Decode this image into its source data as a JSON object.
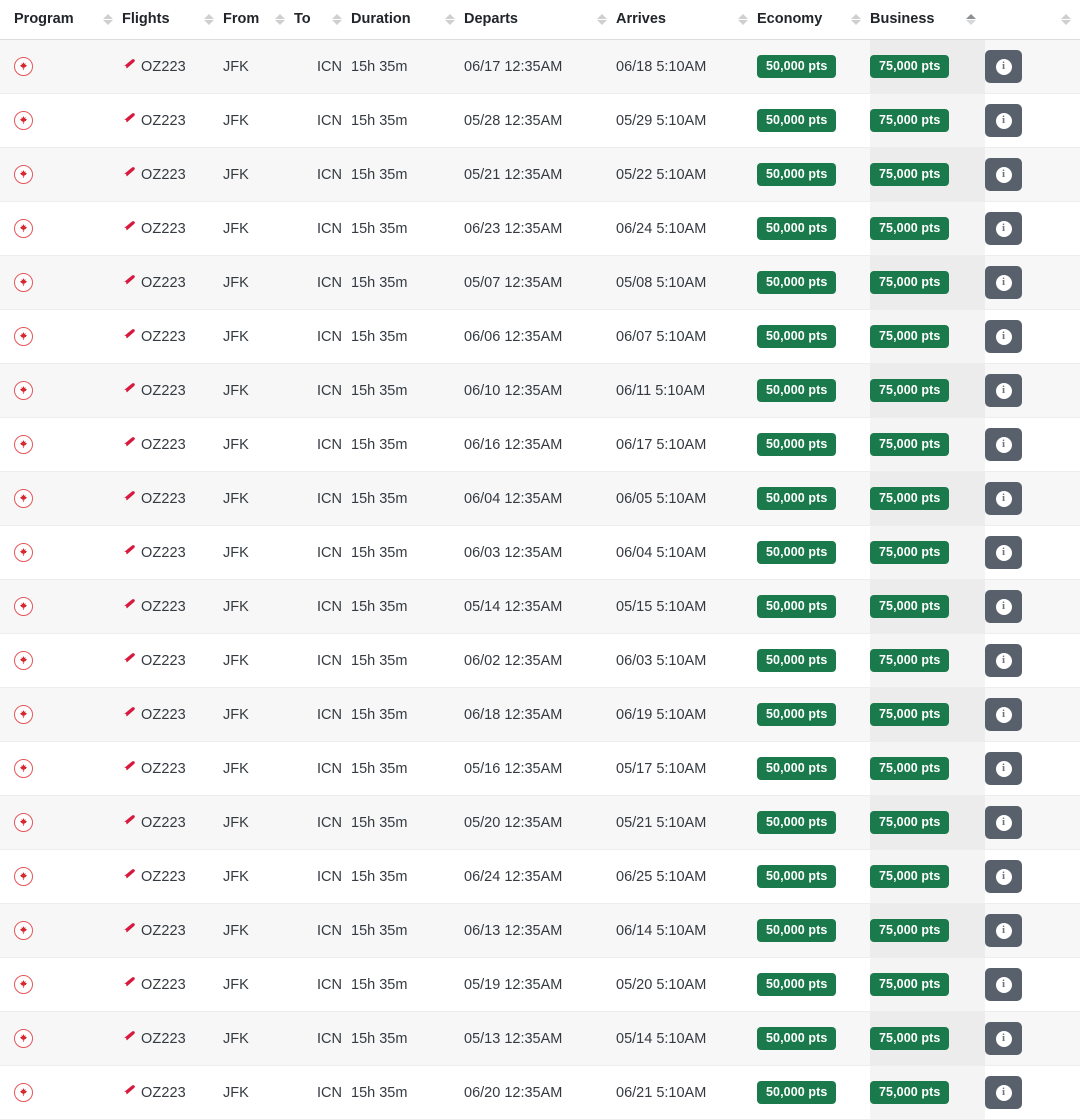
{
  "table": {
    "columns": [
      {
        "key": "program",
        "label": "Program",
        "sortable": true,
        "sort_state": "none"
      },
      {
        "key": "flights",
        "label": "Flights",
        "sortable": true,
        "sort_state": "none"
      },
      {
        "key": "from",
        "label": "From",
        "sortable": true,
        "sort_state": "none"
      },
      {
        "key": "to",
        "label": "To",
        "sortable": true,
        "sort_state": "none"
      },
      {
        "key": "duration",
        "label": "Duration",
        "sortable": true,
        "sort_state": "none"
      },
      {
        "key": "departs",
        "label": "Departs",
        "sortable": true,
        "sort_state": "none"
      },
      {
        "key": "arrives",
        "label": "Arrives",
        "sortable": true,
        "sort_state": "none"
      },
      {
        "key": "economy",
        "label": "Economy",
        "sortable": true,
        "sort_state": "none"
      },
      {
        "key": "business",
        "label": "Business",
        "sortable": true,
        "sort_state": "asc"
      },
      {
        "key": "info",
        "label": "",
        "sortable": true,
        "sort_state": "none"
      }
    ],
    "icons": {
      "program_logo": "aeroplan-maple-leaf-icon",
      "flight": "airplane-takeoff-icon",
      "info": "info-circle-icon",
      "sort": "sort-diamond-icon"
    },
    "colors": {
      "badge_green": "#1b7a4b",
      "info_button": "#58616b",
      "program_logo_red": "#e4565c",
      "plane_icon_red": "#d6193c",
      "row_stripe": "#f7f7f7",
      "sorted_column": "#ececec"
    },
    "rows": [
      {
        "program": "Aeroplan",
        "flight": "OZ223",
        "from": "JFK",
        "to": "ICN",
        "duration": "15h 35m",
        "departs": "06/17 12:35AM",
        "arrives": "06/18 5:10AM",
        "economy": "50,000 pts",
        "business": "75,000 pts",
        "info_label": "i"
      },
      {
        "program": "Aeroplan",
        "flight": "OZ223",
        "from": "JFK",
        "to": "ICN",
        "duration": "15h 35m",
        "departs": "05/28 12:35AM",
        "arrives": "05/29 5:10AM",
        "economy": "50,000 pts",
        "business": "75,000 pts",
        "info_label": "i"
      },
      {
        "program": "Aeroplan",
        "flight": "OZ223",
        "from": "JFK",
        "to": "ICN",
        "duration": "15h 35m",
        "departs": "05/21 12:35AM",
        "arrives": "05/22 5:10AM",
        "economy": "50,000 pts",
        "business": "75,000 pts",
        "info_label": "i"
      },
      {
        "program": "Aeroplan",
        "flight": "OZ223",
        "from": "JFK",
        "to": "ICN",
        "duration": "15h 35m",
        "departs": "06/23 12:35AM",
        "arrives": "06/24 5:10AM",
        "economy": "50,000 pts",
        "business": "75,000 pts",
        "info_label": "i"
      },
      {
        "program": "Aeroplan",
        "flight": "OZ223",
        "from": "JFK",
        "to": "ICN",
        "duration": "15h 35m",
        "departs": "05/07 12:35AM",
        "arrives": "05/08 5:10AM",
        "economy": "50,000 pts",
        "business": "75,000 pts",
        "info_label": "i"
      },
      {
        "program": "Aeroplan",
        "flight": "OZ223",
        "from": "JFK",
        "to": "ICN",
        "duration": "15h 35m",
        "departs": "06/06 12:35AM",
        "arrives": "06/07 5:10AM",
        "economy": "50,000 pts",
        "business": "75,000 pts",
        "info_label": "i"
      },
      {
        "program": "Aeroplan",
        "flight": "OZ223",
        "from": "JFK",
        "to": "ICN",
        "duration": "15h 35m",
        "departs": "06/10 12:35AM",
        "arrives": "06/11 5:10AM",
        "economy": "50,000 pts",
        "business": "75,000 pts",
        "info_label": "i"
      },
      {
        "program": "Aeroplan",
        "flight": "OZ223",
        "from": "JFK",
        "to": "ICN",
        "duration": "15h 35m",
        "departs": "06/16 12:35AM",
        "arrives": "06/17 5:10AM",
        "economy": "50,000 pts",
        "business": "75,000 pts",
        "info_label": "i"
      },
      {
        "program": "Aeroplan",
        "flight": "OZ223",
        "from": "JFK",
        "to": "ICN",
        "duration": "15h 35m",
        "departs": "06/04 12:35AM",
        "arrives": "06/05 5:10AM",
        "economy": "50,000 pts",
        "business": "75,000 pts",
        "info_label": "i"
      },
      {
        "program": "Aeroplan",
        "flight": "OZ223",
        "from": "JFK",
        "to": "ICN",
        "duration": "15h 35m",
        "departs": "06/03 12:35AM",
        "arrives": "06/04 5:10AM",
        "economy": "50,000 pts",
        "business": "75,000 pts",
        "info_label": "i"
      },
      {
        "program": "Aeroplan",
        "flight": "OZ223",
        "from": "JFK",
        "to": "ICN",
        "duration": "15h 35m",
        "departs": "05/14 12:35AM",
        "arrives": "05/15 5:10AM",
        "economy": "50,000 pts",
        "business": "75,000 pts",
        "info_label": "i"
      },
      {
        "program": "Aeroplan",
        "flight": "OZ223",
        "from": "JFK",
        "to": "ICN",
        "duration": "15h 35m",
        "departs": "06/02 12:35AM",
        "arrives": "06/03 5:10AM",
        "economy": "50,000 pts",
        "business": "75,000 pts",
        "info_label": "i"
      },
      {
        "program": "Aeroplan",
        "flight": "OZ223",
        "from": "JFK",
        "to": "ICN",
        "duration": "15h 35m",
        "departs": "06/18 12:35AM",
        "arrives": "06/19 5:10AM",
        "economy": "50,000 pts",
        "business": "75,000 pts",
        "info_label": "i"
      },
      {
        "program": "Aeroplan",
        "flight": "OZ223",
        "from": "JFK",
        "to": "ICN",
        "duration": "15h 35m",
        "departs": "05/16 12:35AM",
        "arrives": "05/17 5:10AM",
        "economy": "50,000 pts",
        "business": "75,000 pts",
        "info_label": "i"
      },
      {
        "program": "Aeroplan",
        "flight": "OZ223",
        "from": "JFK",
        "to": "ICN",
        "duration": "15h 35m",
        "departs": "05/20 12:35AM",
        "arrives": "05/21 5:10AM",
        "economy": "50,000 pts",
        "business": "75,000 pts",
        "info_label": "i"
      },
      {
        "program": "Aeroplan",
        "flight": "OZ223",
        "from": "JFK",
        "to": "ICN",
        "duration": "15h 35m",
        "departs": "06/24 12:35AM",
        "arrives": "06/25 5:10AM",
        "economy": "50,000 pts",
        "business": "75,000 pts",
        "info_label": "i"
      },
      {
        "program": "Aeroplan",
        "flight": "OZ223",
        "from": "JFK",
        "to": "ICN",
        "duration": "15h 35m",
        "departs": "06/13 12:35AM",
        "arrives": "06/14 5:10AM",
        "economy": "50,000 pts",
        "business": "75,000 pts",
        "info_label": "i"
      },
      {
        "program": "Aeroplan",
        "flight": "OZ223",
        "from": "JFK",
        "to": "ICN",
        "duration": "15h 35m",
        "departs": "05/19 12:35AM",
        "arrives": "05/20 5:10AM",
        "economy": "50,000 pts",
        "business": "75,000 pts",
        "info_label": "i"
      },
      {
        "program": "Aeroplan",
        "flight": "OZ223",
        "from": "JFK",
        "to": "ICN",
        "duration": "15h 35m",
        "departs": "05/13 12:35AM",
        "arrives": "05/14 5:10AM",
        "economy": "50,000 pts",
        "business": "75,000 pts",
        "info_label": "i"
      },
      {
        "program": "Aeroplan",
        "flight": "OZ223",
        "from": "JFK",
        "to": "ICN",
        "duration": "15h 35m",
        "departs": "06/20 12:35AM",
        "arrives": "06/21 5:10AM",
        "economy": "50,000 pts",
        "business": "75,000 pts",
        "info_label": "i"
      }
    ]
  }
}
